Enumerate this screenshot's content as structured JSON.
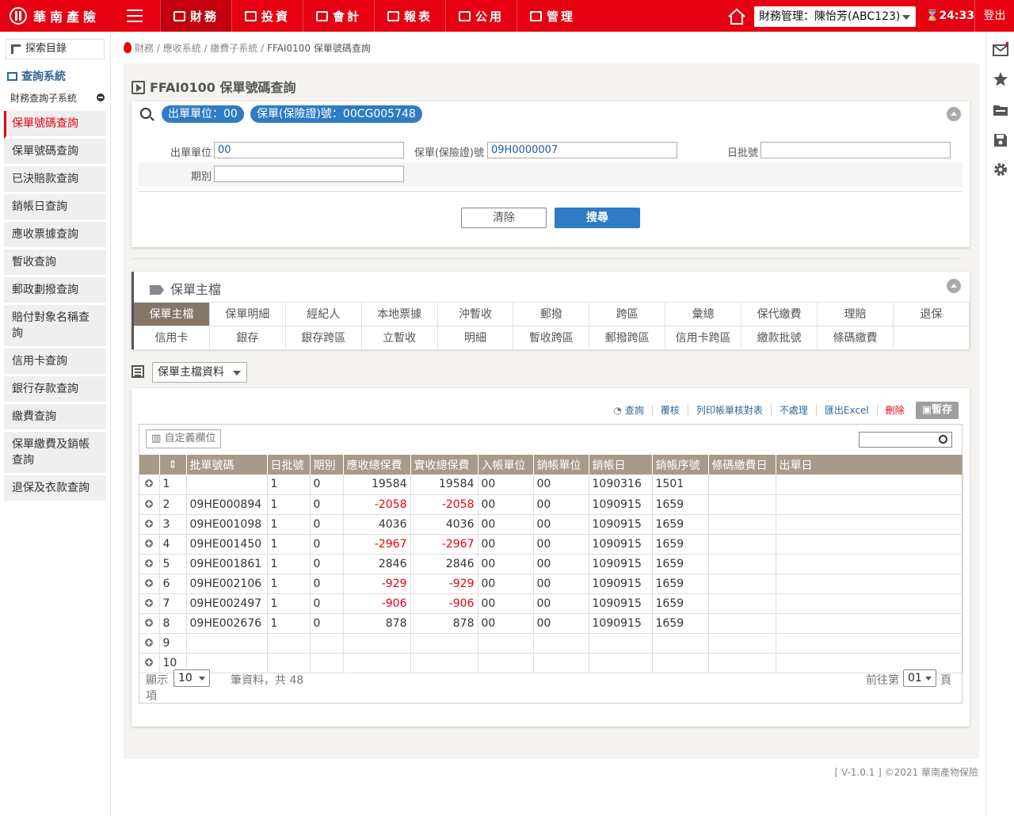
{
  "header": {
    "logo_text": "華南產險",
    "nav": [
      {
        "label": "財務",
        "icon": "dollar-icon",
        "active": true
      },
      {
        "label": "投資",
        "icon": "trophy-icon",
        "active": false
      },
      {
        "label": "會計",
        "icon": "chart-icon",
        "active": false
      },
      {
        "label": "報表",
        "icon": "document-icon",
        "active": false
      },
      {
        "label": "公用",
        "icon": "users-icon",
        "active": false
      },
      {
        "label": "管理",
        "icon": "grid-icon",
        "active": false
      }
    ],
    "role": "財務管理：陳怡芳(ABC123)",
    "timer": "24:33",
    "logout": "登出"
  },
  "sidebar": {
    "search_label": "探索目錄",
    "system_title": "查詢系統",
    "subsystem": "財務查詢子系統",
    "items": [
      "保單號碼查詢",
      "保單號碼查詢",
      "已決賠款查詢",
      "銷帳日查詢",
      "應收票據查詢",
      "暫收查詢",
      "郵政劃撥查詢",
      "賠付對象名稱查詢",
      "信用卡查詢",
      "銀行存款查詢",
      "繳費查詢",
      "保單繳費及銷帳查詢",
      "退保及衣款查詢"
    ]
  },
  "breadcrumb": [
    "財務",
    "應收系統",
    "繳費子系統",
    "FFAI0100 保單號碼查詢"
  ],
  "page_title": "FFAI0100 保單號碼查詢",
  "search": {
    "pills": [
      "出單單位：00",
      "保單(保險證)號：00CG005748"
    ],
    "fields": {
      "unit_label": "出單單位",
      "unit_value": "00",
      "policy_label": "保單(保險證)號",
      "policy_value": "09H0000007",
      "batch_label": "日批號",
      "batch_value": "",
      "period_label": "期別",
      "period_value": ""
    },
    "clear_btn": "清除",
    "search_btn": "搜尋"
  },
  "tabs_panel": {
    "title": "保單主檔",
    "row1": [
      "保單主檔",
      "保單明細",
      "經紀人",
      "本地票據",
      "沖暫收",
      "郵撥",
      "跨區",
      "彙總",
      "保代繳費",
      "理賠",
      "退保"
    ],
    "row2": [
      "信用卡",
      "銀存",
      "銀存跨區",
      "立暫收",
      "明細",
      "暫收跨區",
      "郵撥跨區",
      "信用卡跨區",
      "繳款批號",
      "條碼繳費"
    ]
  },
  "data_select": "保單主檔資料",
  "toolbar": {
    "query": "查詢",
    "review": "覆核",
    "print": "列印帳單核對表",
    "skip": "不處理",
    "export": "匯出Excel",
    "delete": "刪除",
    "save": "暫存"
  },
  "grid": {
    "custom_cols": "自定義欄位",
    "columns": [
      "批單號碼",
      "日批號",
      "期別",
      "應收總保費",
      "實收總保費",
      "入帳單位",
      "銷帳單位",
      "銷帳日",
      "銷帳序號",
      "條碼繳費日",
      "出單日"
    ],
    "rows": [
      [
        "1",
        "",
        "1",
        "0",
        "19584",
        "19584",
        "00",
        "00",
        "1090316",
        "1501",
        "",
        ""
      ],
      [
        "2",
        "09HE000894",
        "1",
        "0",
        "-2058",
        "-2058",
        "00",
        "00",
        "1090915",
        "1659",
        "",
        ""
      ],
      [
        "3",
        "09HE001098",
        "1",
        "0",
        "4036",
        "4036",
        "00",
        "00",
        "1090915",
        "1659",
        "",
        ""
      ],
      [
        "4",
        "09HE001450",
        "1",
        "0",
        "-2967",
        "-2967",
        "00",
        "00",
        "1090915",
        "1659",
        "",
        ""
      ],
      [
        "5",
        "09HE001861",
        "1",
        "0",
        "2846",
        "2846",
        "00",
        "00",
        "1090915",
        "1659",
        "",
        ""
      ],
      [
        "6",
        "09HE002106",
        "1",
        "0",
        "-929",
        "-929",
        "00",
        "00",
        "1090915",
        "1659",
        "",
        ""
      ],
      [
        "7",
        "09HE002497",
        "1",
        "0",
        "-906",
        "-906",
        "00",
        "00",
        "1090915",
        "1659",
        "",
        ""
      ],
      [
        "8",
        "09HE002676",
        "1",
        "0",
        "878",
        "878",
        "00",
        "00",
        "1090915",
        "1659",
        "",
        ""
      ],
      [
        "9",
        "",
        "",
        "",
        "",
        "",
        "",
        "",
        "",
        "",
        "",
        ""
      ],
      [
        "10",
        "",
        "",
        "",
        "",
        "",
        "",
        "",
        "",
        "",
        "",
        ""
      ]
    ],
    "footer": {
      "show_label": "顯示",
      "page_size": "10",
      "items_label": "項",
      "total_text": "筆資料，共 48",
      "goto_label": "前往第",
      "page_value": "01",
      "page_suffix": "頁"
    }
  },
  "copyright": "[ V-1.0.1 ] ©2021 華南產物保險"
}
